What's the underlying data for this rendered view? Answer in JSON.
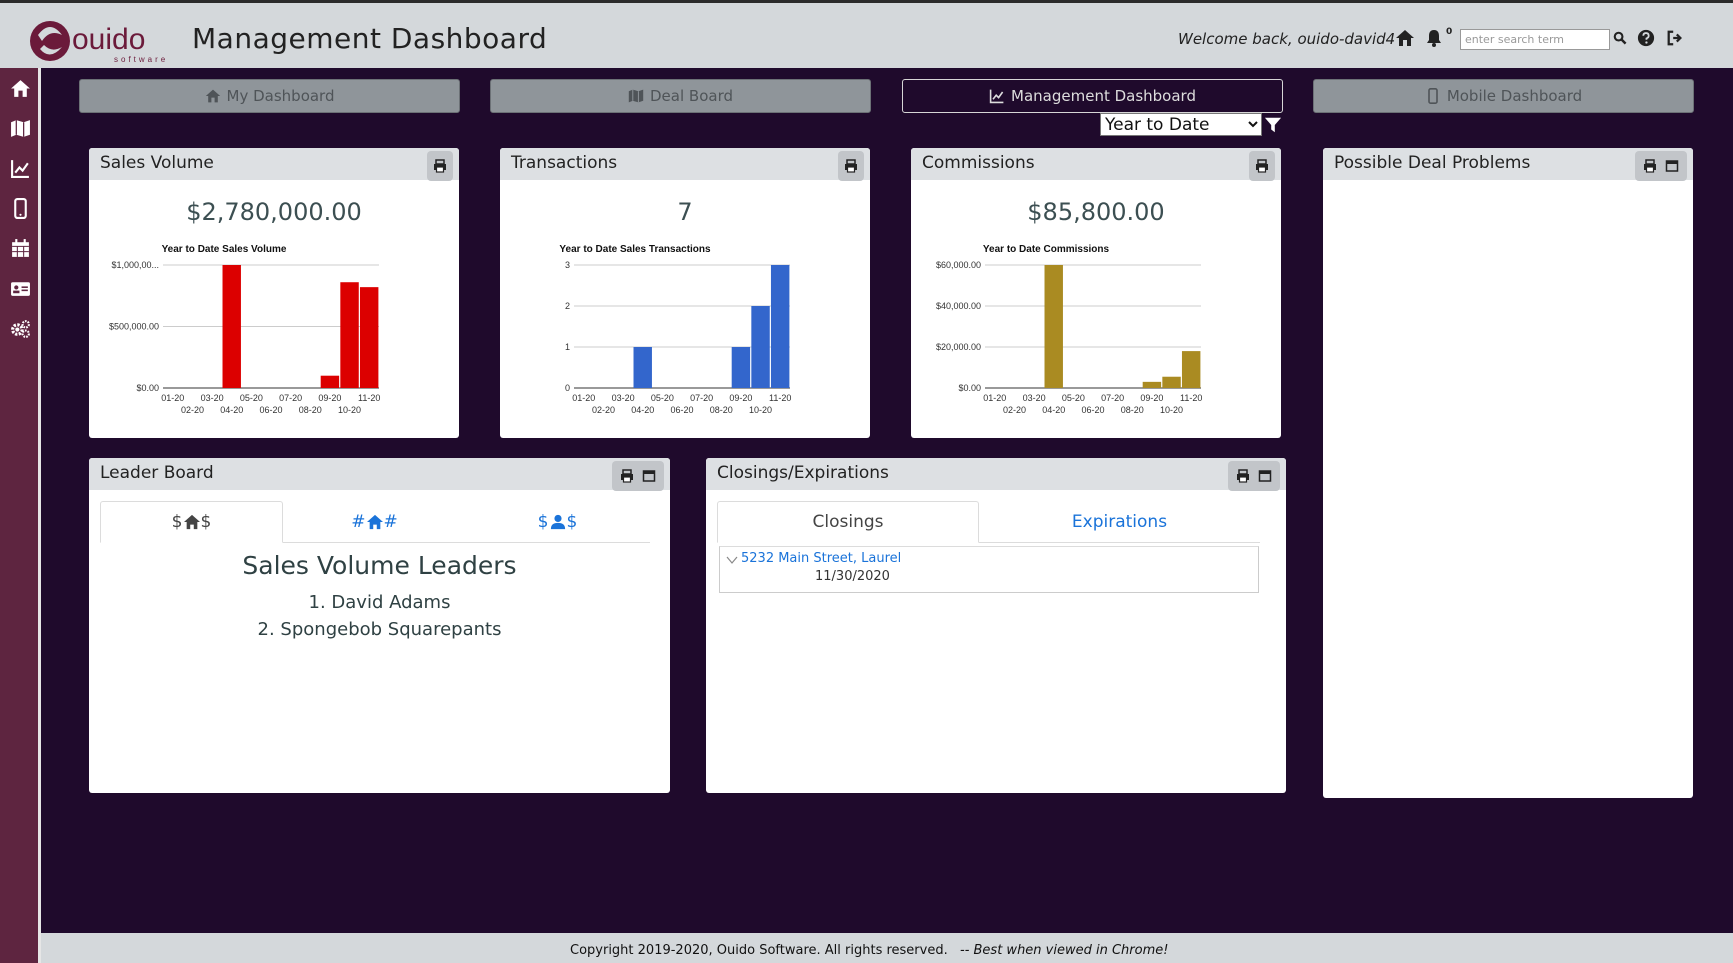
{
  "header": {
    "logo_text": "ouido",
    "logo_subtext": "software",
    "title": "Management Dashboard",
    "welcome": "Welcome back, ouido-david4",
    "notification_count": "0",
    "search_placeholder": "enter search term"
  },
  "sidebar": {
    "items": [
      "home-icon",
      "map-icon",
      "chart-line-icon",
      "mobile-icon",
      "calendar-icon",
      "id-card-icon",
      "cogs-icon"
    ]
  },
  "nav": {
    "my_dashboard": "My Dashboard",
    "deal_board": "Deal Board",
    "management_dashboard": "Management Dashboard",
    "mobile_dashboard": "Mobile Dashboard"
  },
  "period_filter": {
    "selected": "Year to Date"
  },
  "cards": {
    "sales_volume": {
      "title": "Sales Volume",
      "value": "$2,780,000.00"
    },
    "transactions": {
      "title": "Transactions",
      "value": "7"
    },
    "commissions": {
      "title": "Commissions",
      "value": "$85,800.00"
    },
    "possible_problems": {
      "title": "Possible Deal Problems"
    },
    "leader_board": {
      "title": "Leader Board",
      "tabs": [
        "$",
        "$",
        "#",
        "#",
        "$",
        "$"
      ],
      "heading": "Sales Volume Leaders",
      "leaders": [
        "1. David Adams",
        "2. Spongebob Squarepants"
      ]
    },
    "closings": {
      "title": "Closings/Expirations",
      "tabs": [
        "Closings",
        "Expirations"
      ],
      "items": [
        {
          "address": "5232 Main Street, Laurel",
          "date": "11/30/2020"
        }
      ]
    }
  },
  "chart_data": [
    {
      "type": "bar",
      "title": "Year to Date Sales Volume",
      "categories": [
        "01-20",
        "02-20",
        "03-20",
        "04-20",
        "05-20",
        "06-20",
        "07-20",
        "08-20",
        "09-20",
        "10-20",
        "11-20"
      ],
      "values": [
        0,
        0,
        0,
        1000000,
        0,
        0,
        0,
        0,
        100000,
        860000,
        820000
      ],
      "ylim": [
        0,
        1000000
      ],
      "yticks": [
        "$0.00",
        "$500,000.00",
        "$1,000,00..."
      ],
      "color": "#dc0000"
    },
    {
      "type": "bar",
      "title": "Year to Date Sales Transactions",
      "categories": [
        "01-20",
        "02-20",
        "03-20",
        "04-20",
        "05-20",
        "06-20",
        "07-20",
        "08-20",
        "09-20",
        "10-20",
        "11-20"
      ],
      "values": [
        0,
        0,
        0,
        1,
        0,
        0,
        0,
        0,
        1,
        2,
        3
      ],
      "ylim": [
        0,
        3
      ],
      "yticks": [
        "0",
        "1",
        "2",
        "3"
      ],
      "color": "#3366cc"
    },
    {
      "type": "bar",
      "title": "Year to Date Commissions",
      "categories": [
        "01-20",
        "02-20",
        "03-20",
        "04-20",
        "05-20",
        "06-20",
        "07-20",
        "08-20",
        "09-20",
        "10-20",
        "11-20"
      ],
      "values": [
        0,
        0,
        0,
        60000,
        0,
        0,
        0,
        0,
        3000,
        5500,
        18000
      ],
      "ylim": [
        0,
        60000
      ],
      "yticks": [
        "$0.00",
        "$20,000.00",
        "$40,000.00",
        "$60,000.00"
      ],
      "color": "#aa8b22"
    }
  ],
  "footer": {
    "copyright": "Copyright 2019-2020, Ouido Software. All rights reserved.",
    "note": "-- Best when viewed in Chrome!"
  }
}
